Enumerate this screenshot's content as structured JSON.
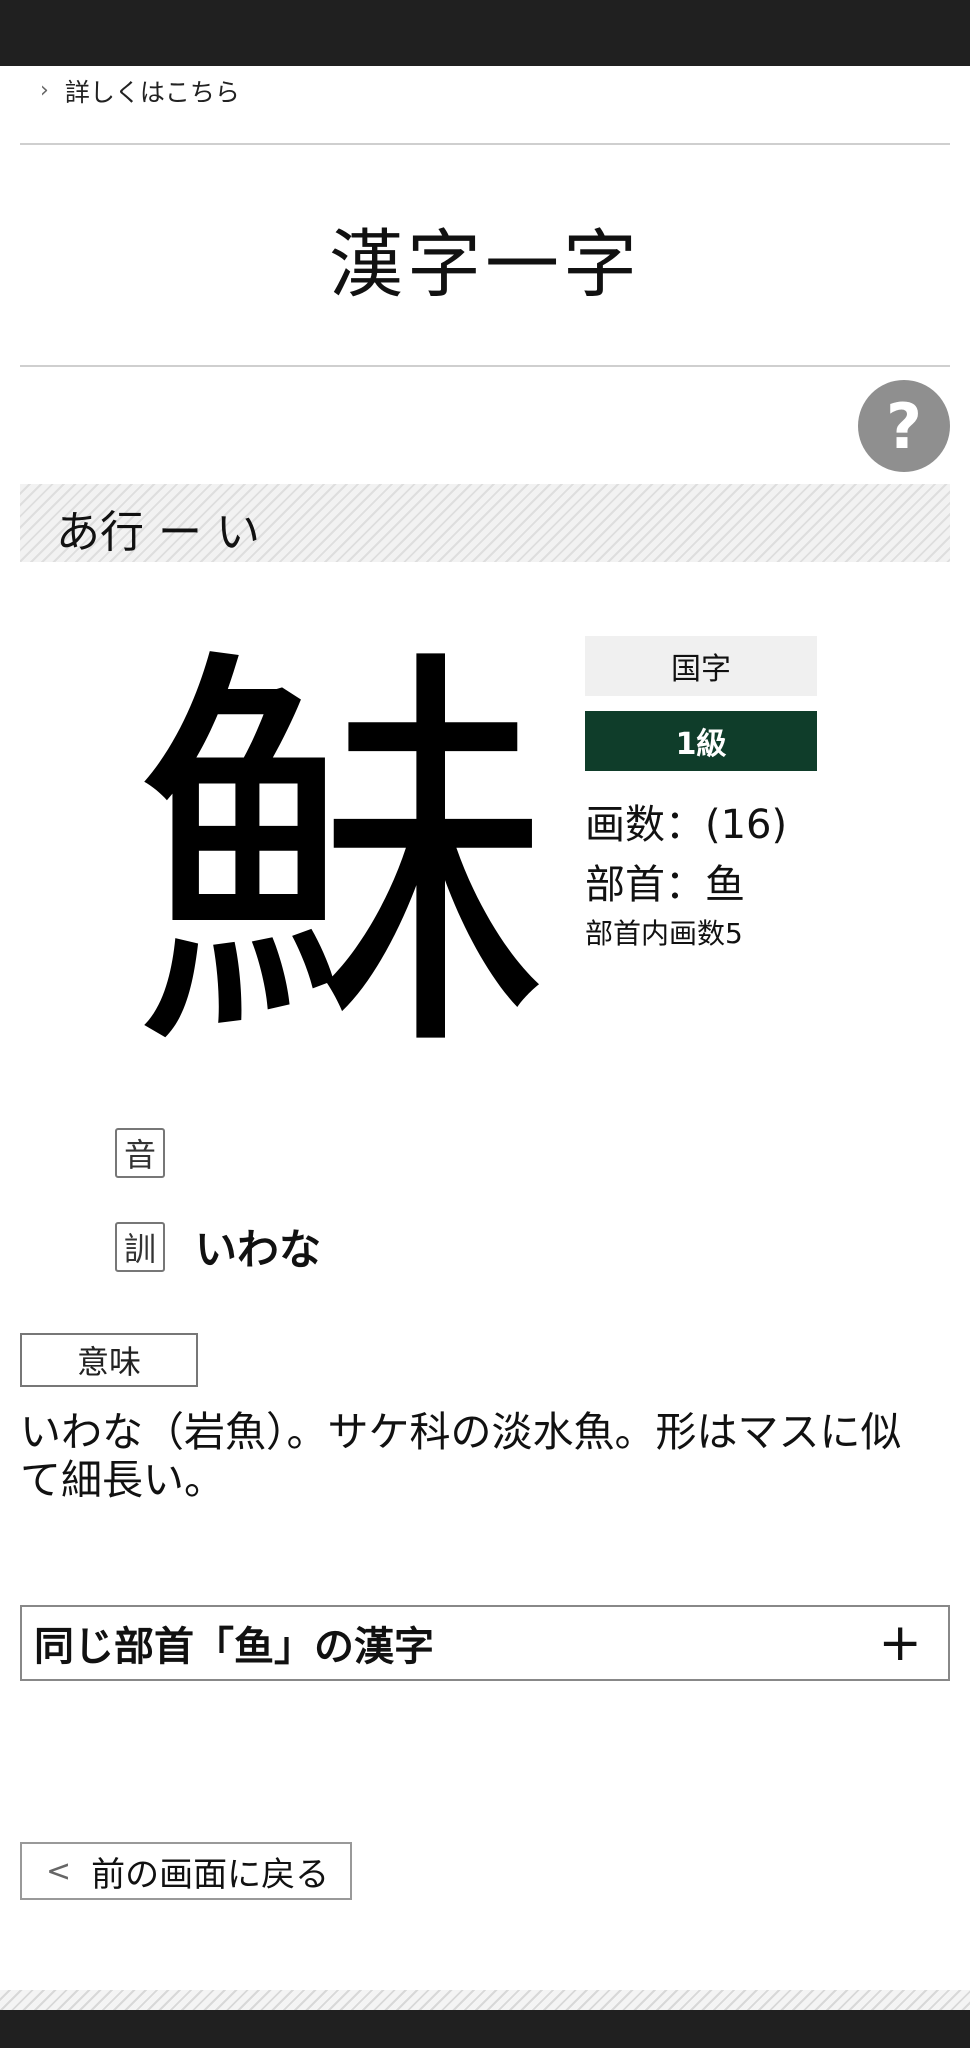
{
  "header": {
    "more_link": "詳しくはこちら"
  },
  "page_title": "漢字一字",
  "help_icon": "?",
  "section": {
    "label": "あ行 ー い"
  },
  "kanji": {
    "character": "鮇",
    "type_tag": "国字",
    "level_tag": "1級",
    "stroke_count": "画数：(16)",
    "radical": "部首：⻥",
    "radical_strokes": "部首内画数5"
  },
  "readings": {
    "on_label": "音",
    "on_value": "",
    "kun_label": "訓",
    "kun_value": "いわな"
  },
  "meaning": {
    "label": "意味",
    "text": "いわな（岩魚）。サケ科の淡水魚。形はマスに似て細長い。"
  },
  "accordion": {
    "title": "同じ部首「⻥」の漢字",
    "icon": "+"
  },
  "back_button": {
    "label": "前の画面に戻る",
    "icon": "<"
  },
  "colors": {
    "level_tag_bg": "#0f3d2a",
    "help_bg": "#8f8f8f",
    "bar": "#202020"
  }
}
